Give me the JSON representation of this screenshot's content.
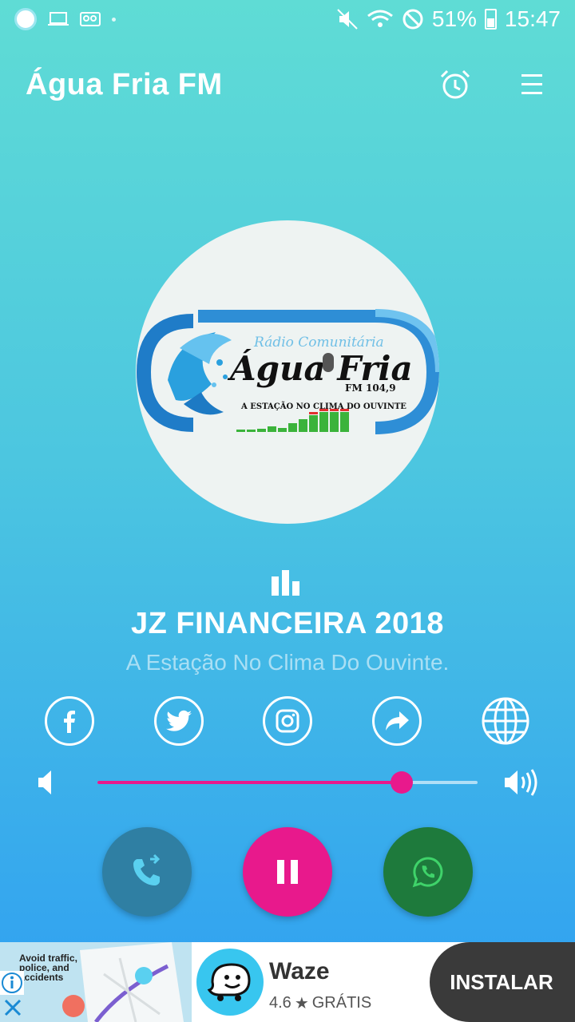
{
  "status_bar": {
    "battery": "51%",
    "time": "15:47"
  },
  "app_bar": {
    "title": "Água Fria FM"
  },
  "station_logo": {
    "top_text": "Rádio Comunitária",
    "name_text": "Água Fria",
    "freq_text": "FM 104,9",
    "slogan_text": "A ESTAÇÃO NO CLIMA DO OUVINTE"
  },
  "now_playing": {
    "title": "JZ FINANCEIRA 2018",
    "subtitle": "A Estação No Clima Do Ouvinte."
  },
  "social": [
    {
      "name": "facebook",
      "icon": "facebook-icon"
    },
    {
      "name": "twitter",
      "icon": "twitter-icon"
    },
    {
      "name": "instagram",
      "icon": "instagram-icon"
    },
    {
      "name": "share",
      "icon": "share-icon"
    },
    {
      "name": "website",
      "icon": "globe-icon"
    }
  ],
  "volume": {
    "level": 0.8
  },
  "colors": {
    "accent": "#e8198c",
    "call": "#2f7fa3",
    "whatsapp": "#1e7a3c"
  },
  "ad": {
    "image_text": "Avoid traffic, police, and accidents",
    "app_name": "Waze",
    "rating": "4.6",
    "price": "GRÁTIS",
    "cta": "INSTALAR"
  }
}
